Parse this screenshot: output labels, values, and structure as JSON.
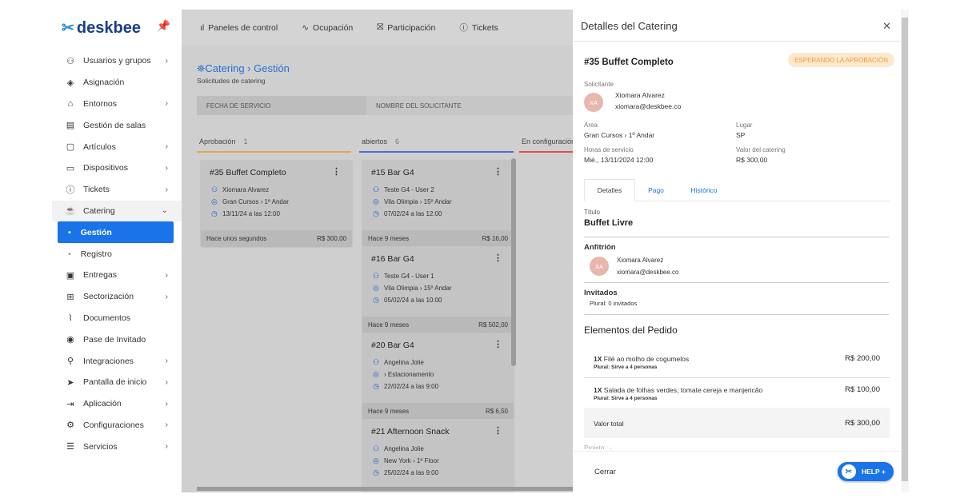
{
  "sidebar": {
    "logo": "deskbee",
    "items": [
      {
        "icon": "users-icon",
        "glyph": "⚇",
        "label": "Usuarios y grupos",
        "chevron": true
      },
      {
        "icon": "layers-icon",
        "glyph": "◈",
        "label": "Asignación",
        "chevron": false
      },
      {
        "icon": "building-icon",
        "glyph": "⌂",
        "label": "Entornos",
        "chevron": true
      },
      {
        "icon": "calendar-icon",
        "glyph": "▤",
        "label": "Gestión de salas",
        "chevron": false
      },
      {
        "icon": "clipboard-icon",
        "glyph": "▢",
        "label": "Artículos",
        "chevron": true
      },
      {
        "icon": "devices-icon",
        "glyph": "▭",
        "label": "Dispositivos",
        "chevron": true
      },
      {
        "icon": "info-icon",
        "glyph": "ⓘ",
        "label": "Tickets",
        "chevron": true
      },
      {
        "icon": "catering-icon",
        "glyph": "☕",
        "label": "Catering",
        "chevron": true,
        "open": true
      },
      {
        "label": "Gestión",
        "sub": true,
        "current": true
      },
      {
        "label": "Registro",
        "sub": true
      },
      {
        "icon": "package-icon",
        "glyph": "▣",
        "label": "Entregas",
        "chevron": true
      },
      {
        "icon": "grid-icon",
        "glyph": "⊞",
        "label": "Sectorización",
        "chevron": true
      },
      {
        "icon": "paperclip-icon",
        "glyph": "⌇",
        "label": "Documentos",
        "chevron": false
      },
      {
        "icon": "guest-pass-icon",
        "glyph": "◉",
        "label": "Pase de Invitado",
        "chevron": false
      },
      {
        "icon": "plug-icon",
        "glyph": "⚲",
        "label": "Integraciones",
        "chevron": true
      },
      {
        "icon": "send-icon",
        "glyph": "➤",
        "label": "Pantalla de inicio",
        "chevron": true
      },
      {
        "icon": "app-icon",
        "glyph": "⇥",
        "label": "Aplicación",
        "chevron": true
      },
      {
        "icon": "settings-icon",
        "glyph": "⚙",
        "label": "Configuraciones",
        "chevron": true
      },
      {
        "icon": "server-icon",
        "glyph": "☰",
        "label": "Servicios",
        "chevron": true
      }
    ]
  },
  "topbar": {
    "tabs": [
      {
        "icon": "bar-chart-icon",
        "glyph": "ıl",
        "label": "Paneles de control"
      },
      {
        "icon": "activity-icon",
        "glyph": "∿",
        "label": "Ocupación"
      },
      {
        "icon": "gift-icon",
        "glyph": "⛝",
        "label": "Participación"
      },
      {
        "icon": "info-icon",
        "glyph": "ⓘ",
        "label": "Tickets"
      }
    ]
  },
  "page": {
    "breadcrumb": "Catering › Gestión",
    "subtitle": "Solicitudes de catering"
  },
  "filters": {
    "date": "FECHA DE SERVICIO",
    "name": "NOMBRE DEL SOLICITANTE"
  },
  "columns": [
    {
      "title": "Aprobación",
      "count": "1",
      "color": "#e5a550"
    },
    {
      "title": "abiertos",
      "count": "6",
      "color": "#4a6fd0"
    },
    {
      "title": "En configuración",
      "count": "",
      "color": "#d95050"
    }
  ],
  "cards": [
    {
      "title": "#35 Buffet Completo",
      "user": "Xiomara Alvarez",
      "place": "Gran Cursos › 1º Andar",
      "time": "13/11/24 a las 12:00",
      "ago": "Hace unos segundos",
      "price": "R$ 300,00"
    },
    {
      "title": "#15 Bar G4",
      "user": "Teste G4 - User 2",
      "place": "Vila Olimpia › 15º Andar",
      "time": "07/02/24 a las 12:00",
      "ago": "Hace 9 meses",
      "price": "R$ 16,00"
    },
    {
      "title": "#16 Bar G4",
      "user": "Teste G4 - User 1",
      "place": "Vila Olimpia › 15º Andar",
      "time": "05/02/24 a las 10:00",
      "ago": "Hace 9 meses",
      "price": "R$ 502,00"
    },
    {
      "title": "#20 Bar G4",
      "user": "Angelina Jolie",
      "place": "› Estacionamento",
      "time": "22/02/24 a las 9:00",
      "ago": "Hace 9 meses",
      "price": "R$ 6,50"
    },
    {
      "title": "#21 Afternoon Snack",
      "user": "Angelina Jolie",
      "place": "New York › 1º Floor",
      "time": "25/02/24 a las 9:00",
      "ago": "",
      "price": ""
    }
  ],
  "panel": {
    "title": "Detalles del Catering",
    "order_title": "#35 Buffet Completo",
    "status": "ESPERANDO LA APROBACIÓN",
    "requester_label": "Solicitante",
    "requester_initials": "XA",
    "requester_name": "Xiomara Alvarez",
    "requester_email": "xiomara@deskbee.co",
    "area_label": "Área",
    "area": "Gran Cursos › 1º Andar",
    "place_label": "Lugar",
    "place": "SP",
    "hours_label": "Horas de servicio",
    "hours": "Mié., 13/11/2024 12:00",
    "value_label": "Valor del catering",
    "value": "R$ 300,00",
    "tabs": [
      "Detalles",
      "Pago",
      "Histórico"
    ],
    "titulo_label": "Título",
    "titulo": "Buffet Livre",
    "host_label": "Anfitrión",
    "host_initials": "XA",
    "host_name": "Xiomara Alvarez",
    "host_email": "xiomara@deskbee.co",
    "guests_label": "Invitados",
    "guests": "Plural: 0 invitados",
    "items_heading": "Elementos del Pedido",
    "items": [
      {
        "qty": "1X",
        "name": "Filé ao molho de cogumelos",
        "note": "Plural: Sirve a 4 personas",
        "price": "R$ 200,00"
      },
      {
        "qty": "1X",
        "name": "Salada de folhas verdes, tomate cereja e manjericão",
        "note": "Plural: Sirve a 4 personas",
        "price": "R$ 100,00"
      }
    ],
    "total_label": "Valor total",
    "total": "R$ 300,00",
    "projeto": "Projeto : -",
    "close_label": "Cerrar",
    "help_label": "HELP +"
  }
}
